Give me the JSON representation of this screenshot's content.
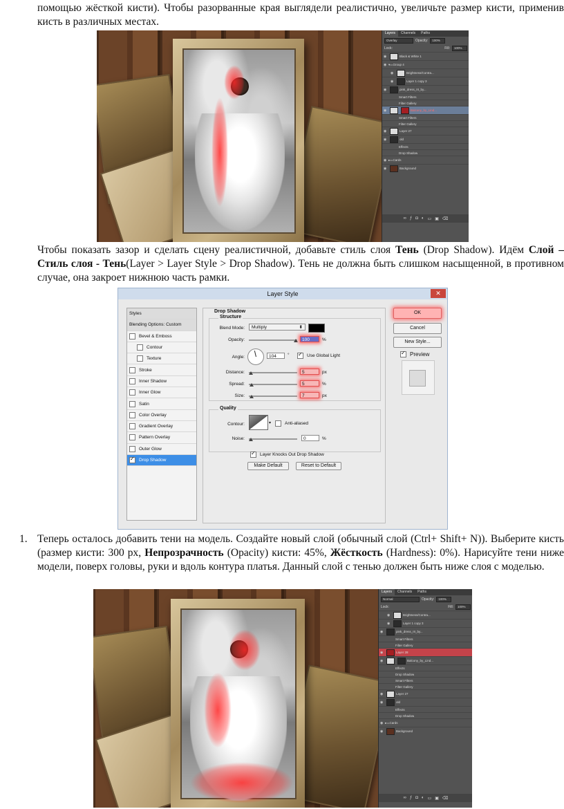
{
  "text": {
    "para1": "помощью жёсткой кисти). Чтобы разорванные края выглядели реалистично, увеличьте размер кисти, применив кисть в различных местах.",
    "para2_a": "Чтобы показать зазор и сделать сцену реалистичной, добавьте стиль слоя ",
    "para2_b": "Тень",
    "para2_c": " (Drop Shadow). Идём ",
    "para2_d": "Слой – Стиль слоя - Тень",
    "para2_e": "(Layer > Layer Style > Drop Shadow). Тень не должна быть слишком насыщенной, в противном случае, она закроет нижнюю часть рамки.",
    "item1_num": "1.",
    "item1_a": "Теперь осталось добавить тени на модель. Создайте новый слой (обычный слой (Ctrl+ Shift+ N)). Выберите кисть (размер кисти: 300 px, ",
    "item1_b": "Непрозрачность",
    "item1_c": " (Opacity) кисти: 45%, ",
    "item1_d": "Жёсткость",
    "item1_e": " (Hardness): 0%). Нарисуйте тени ниже модели, поверх головы, руки и вдоль контура платья. Данный слой с тенью должен быть ниже слоя с моделью."
  },
  "panel1": {
    "tabs": [
      "Layers",
      "Channels",
      "Paths"
    ],
    "blend": "Overlay",
    "opacity_label": "Opacity:",
    "opacity": "100%",
    "lock_label": "Lock:",
    "fill_label": "Fill:",
    "fill": "100%",
    "layers": [
      {
        "name": "Black & White 1"
      },
      {
        "name": "Group 4"
      },
      {
        "name": "Brightness/Contra..."
      },
      {
        "name": "Layer 1 copy 3"
      },
      {
        "name": "pink_dress_III_by..."
      },
      {
        "name": "Smart Filters"
      },
      {
        "name": "Filter Gallery"
      },
      {
        "name": "Balcony_by_Lind..."
      },
      {
        "name": "Smart Filters"
      },
      {
        "name": "Filter Gallery"
      },
      {
        "name": "Layer 27"
      },
      {
        "name": "old"
      },
      {
        "name": "Effects"
      },
      {
        "name": "Drop Shadow"
      },
      {
        "name": "Cards"
      },
      {
        "name": "Background"
      }
    ]
  },
  "dialog": {
    "title": "Layer Style",
    "styles_header": "Styles",
    "blending": "Blending Options: Custom",
    "items": [
      "Bevel & Emboss",
      "Contour",
      "Texture",
      "Stroke",
      "Inner Shadow",
      "Inner Glow",
      "Satin",
      "Color Overlay",
      "Gradient Overlay",
      "Pattern Overlay",
      "Outer Glow",
      "Drop Shadow"
    ],
    "section_title": "Drop Shadow",
    "structure": "Structure",
    "blend_mode_label": "Blend Mode:",
    "blend_mode": "Multiply",
    "opacity_label": "Opacity:",
    "opacity": "100",
    "pct": "%",
    "angle_label": "Angle:",
    "angle": "104",
    "deg": "°",
    "use_global_light": "Use Global Light",
    "distance_label": "Distance:",
    "distance": "5",
    "spread_label": "Spread:",
    "spread": "5",
    "size_label": "Size:",
    "size": "7",
    "px": "px",
    "quality": "Quality",
    "contour_label": "Contour:",
    "anti_aliased": "Anti-aliased",
    "noise_label": "Noise:",
    "noise": "0",
    "knocks_out": "Layer Knocks Out Drop Shadow",
    "make_default": "Make Default",
    "reset_default": "Reset to Default",
    "ok": "OK",
    "cancel": "Cancel",
    "new_style": "New Style...",
    "preview": "Preview"
  },
  "panel2": {
    "tabs": [
      "Layers",
      "Channels",
      "Paths"
    ],
    "blend": "Normal",
    "opacity_label": "Opacity:",
    "opacity": "100%",
    "lock_label": "Lock:",
    "fill_label": "Fill:",
    "fill": "100%",
    "layers": [
      {
        "name": "Brightness/Contra..."
      },
      {
        "name": "Layer 1 copy 3"
      },
      {
        "name": "pink_dress_III_by..."
      },
      {
        "name": "Smart Filters"
      },
      {
        "name": "Filter Gallery"
      },
      {
        "name": "Layer 28"
      },
      {
        "name": "Balcony_by_Lind..."
      },
      {
        "name": "Effects"
      },
      {
        "name": "Drop Shadow"
      },
      {
        "name": "Smart Filters"
      },
      {
        "name": "Filter Gallery"
      },
      {
        "name": "Layer 27"
      },
      {
        "name": "old"
      },
      {
        "name": "Effects"
      },
      {
        "name": "Drop Shadow"
      },
      {
        "name": "Cards"
      },
      {
        "name": "Background"
      }
    ]
  },
  "icons": {
    "eye": "eye-icon",
    "close": "close-icon",
    "folder": "folder-icon"
  }
}
